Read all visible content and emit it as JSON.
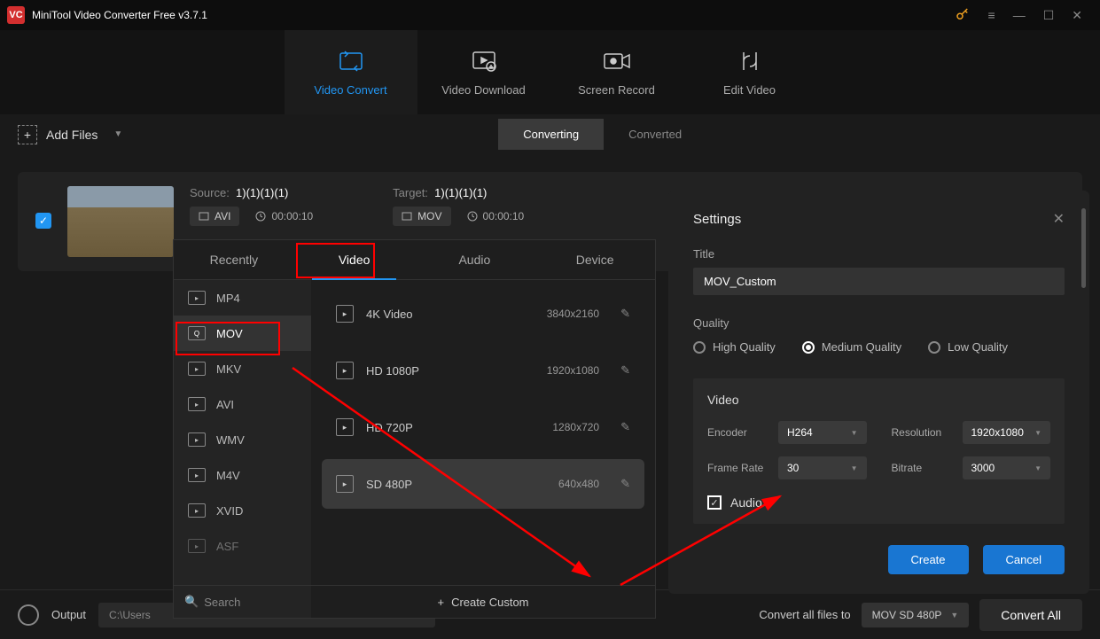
{
  "titlebar": {
    "title": "MiniTool Video Converter Free v3.7.1"
  },
  "mainTabs": {
    "convert": "Video Convert",
    "download": "Video Download",
    "record": "Screen Record",
    "edit": "Edit Video"
  },
  "subbar": {
    "addFiles": "Add Files",
    "converting": "Converting",
    "converted": "Converted"
  },
  "fileRow": {
    "sourceLabel": "Source:",
    "sourceName": "1)(1)(1)(1)",
    "sourceFormat": "AVI",
    "sourceDuration": "00:00:10",
    "targetLabel": "Target:",
    "targetName": "1)(1)(1)(1)",
    "targetFormat": "MOV",
    "targetDuration": "00:00:10"
  },
  "formatTabs": {
    "recently": "Recently",
    "video": "Video",
    "audio": "Audio",
    "device": "Device"
  },
  "formats": {
    "mp4": "MP4",
    "mov": "MOV",
    "mkv": "MKV",
    "avi": "AVI",
    "wmv": "WMV",
    "m4v": "M4V",
    "xvid": "XVID",
    "asf": "ASF"
  },
  "resolutions": [
    {
      "label": "4K Video",
      "res": "3840x2160"
    },
    {
      "label": "HD 1080P",
      "res": "1920x1080"
    },
    {
      "label": "HD 720P",
      "res": "1280x720"
    },
    {
      "label": "SD 480P",
      "res": "640x480"
    }
  ],
  "formatFooter": {
    "search": "Search",
    "createCustom": "Create Custom"
  },
  "settings": {
    "header": "Settings",
    "titleLabel": "Title",
    "titleValue": "MOV_Custom",
    "qualityLabel": "Quality",
    "qHigh": "High Quality",
    "qMedium": "Medium Quality",
    "qLow": "Low Quality",
    "videoLabel": "Video",
    "encoderLabel": "Encoder",
    "encoderValue": "H264",
    "resolutionLabel": "Resolution",
    "resolutionValue": "1920x1080",
    "framerateLabel": "Frame Rate",
    "framerateValue": "30",
    "bitrateLabel": "Bitrate",
    "bitrateValue": "3000",
    "audioLabel": "Audio",
    "create": "Create",
    "cancel": "Cancel"
  },
  "bottom": {
    "outputLabel": "Output",
    "outputPath": "C:\\Users",
    "convertAllLabel": "Convert all files to",
    "convertTarget": "MOV SD 480P",
    "convertAll": "Convert All"
  }
}
